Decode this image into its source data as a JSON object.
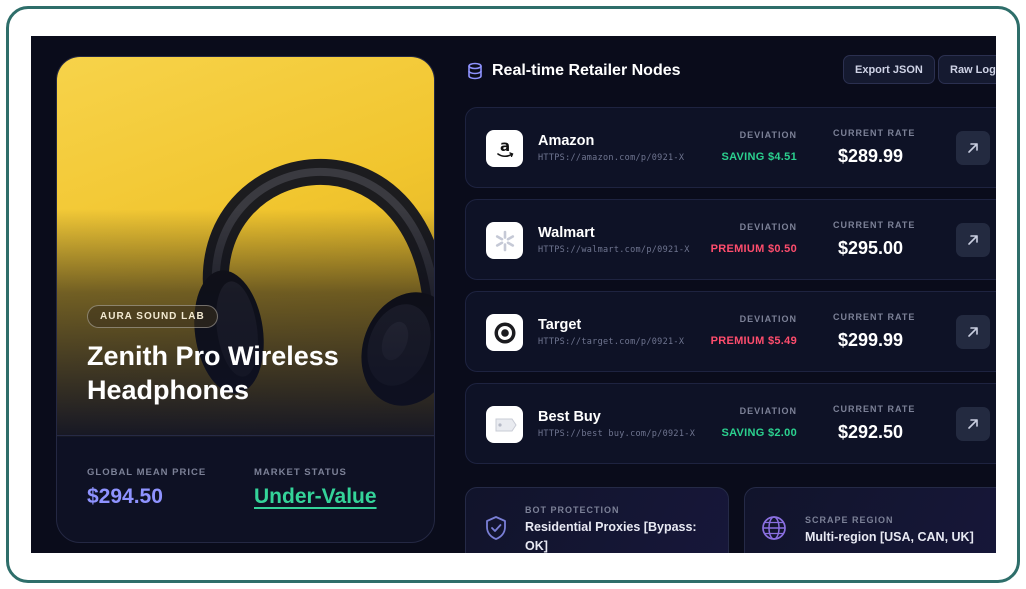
{
  "product": {
    "brand": "AURA SOUND LAB",
    "title": "Zenith Pro Wireless Headphones",
    "mean_price_label": "GLOBAL MEAN PRICE",
    "mean_price": "$294.50",
    "market_status_label": "MARKET STATUS",
    "market_status": "Under-Value"
  },
  "panel": {
    "title": "Real-time Retailer Nodes",
    "export_label": "Export JSON",
    "logs_label": "Raw Logs"
  },
  "nodes": [
    {
      "name": "Amazon",
      "url": "HTTPS://amazon.com/p/0921-X",
      "deviation_label": "DEVIATION",
      "deviation": "SAVING $4.51",
      "deviation_type": "saving",
      "rate_label": "CURRENT RATE",
      "rate": "$289.99",
      "logo_icon": "amazon-logo-icon"
    },
    {
      "name": "Walmart",
      "url": "HTTPS://walmart.com/p/0921-X",
      "deviation_label": "DEVIATION",
      "deviation": "PREMIUM $0.50",
      "deviation_type": "premium",
      "rate_label": "CURRENT RATE",
      "rate": "$295.00",
      "logo_icon": "walmart-spark-icon"
    },
    {
      "name": "Target",
      "url": "HTTPS://target.com/p/0921-X",
      "deviation_label": "DEVIATION",
      "deviation": "PREMIUM $5.49",
      "deviation_type": "premium",
      "rate_label": "CURRENT RATE",
      "rate": "$299.99",
      "logo_icon": "target-bullseye-icon"
    },
    {
      "name": "Best Buy",
      "url": "HTTPS://best buy.com/p/0921-X",
      "deviation_label": "DEVIATION",
      "deviation": "SAVING $2.00",
      "deviation_type": "saving",
      "rate_label": "CURRENT RATE",
      "rate": "$292.50",
      "logo_icon": "bestbuy-tag-icon"
    }
  ],
  "bot_protection": {
    "label": "BOT PROTECTION",
    "value": "Residential Proxies [Bypass: OK]",
    "icon": "shield-check-icon"
  },
  "scrape_region": {
    "label": "SCRAPE REGION",
    "value": "Multi-region [USA, CAN, UK]",
    "icon": "globe-icon"
  },
  "colors": {
    "background": "#0a0c1b",
    "accent": "#8f93ff",
    "saving": "#2bd18f",
    "premium": "#ff4d6d",
    "frame": "#2e6e6a",
    "hero": "#f1c52e"
  }
}
